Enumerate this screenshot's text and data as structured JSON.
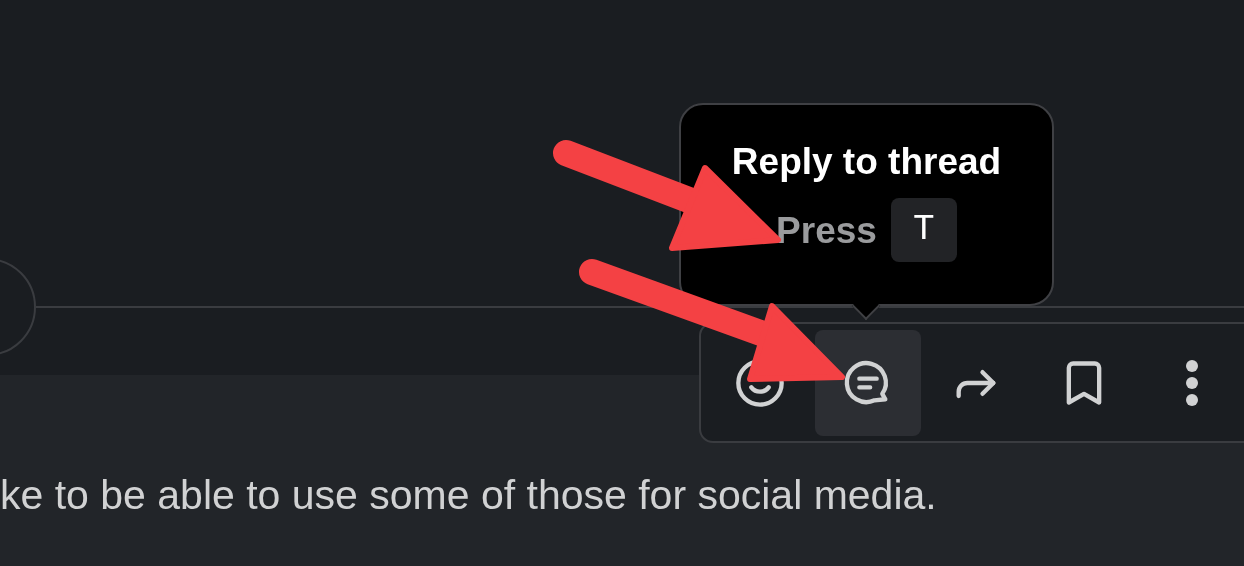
{
  "tooltip": {
    "title": "Reply to thread",
    "hint": "Press",
    "key": "T"
  },
  "message_actions": [
    {
      "kind": "emoji",
      "hovered": false
    },
    {
      "kind": "reply",
      "hovered": true
    },
    {
      "kind": "forward",
      "hovered": false
    },
    {
      "kind": "bookmark",
      "hovered": false
    },
    {
      "kind": "more",
      "hovered": false
    }
  ],
  "message": {
    "text": "ke to be able to use some of those for social media."
  }
}
